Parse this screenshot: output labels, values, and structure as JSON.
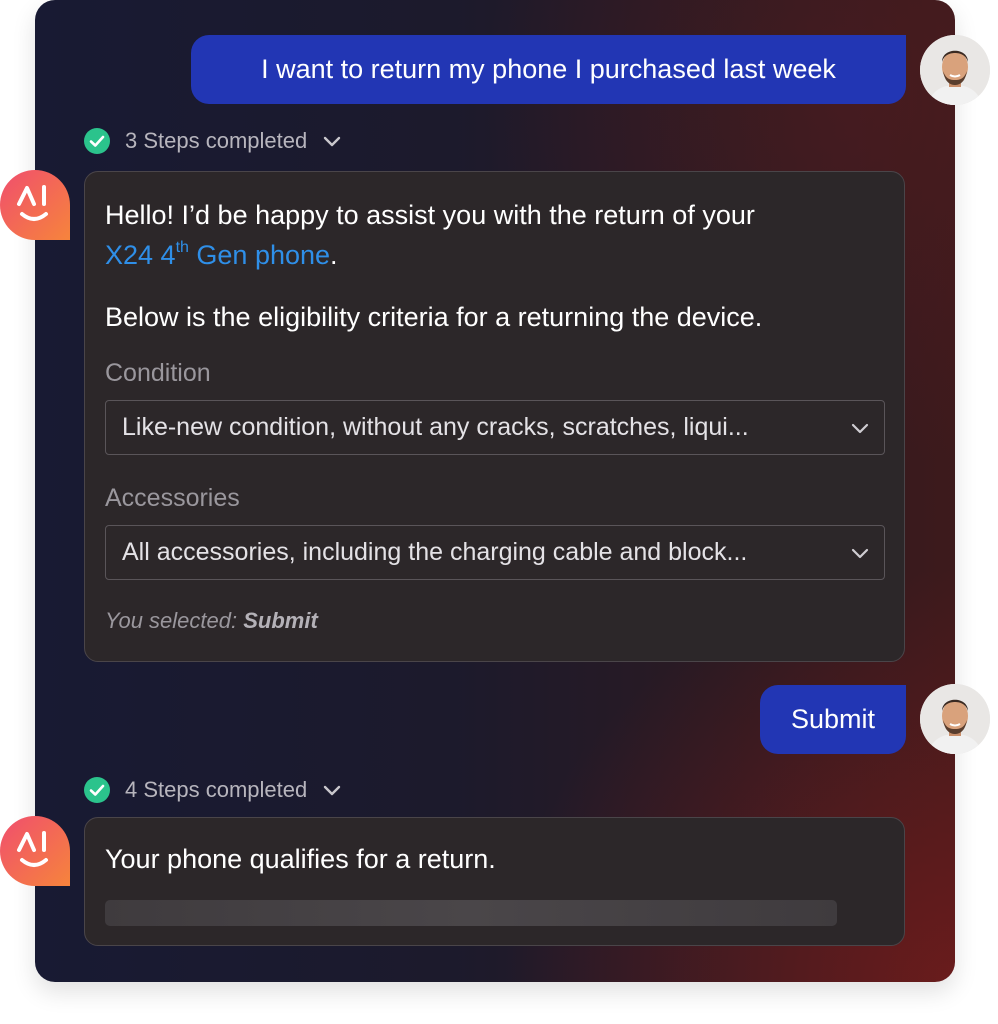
{
  "conversation": {
    "user_message_1": "I want to return my phone I purchased last week",
    "steps_1": "3 Steps completed",
    "ai_reply_1": {
      "greeting": "Hello! I’d be happy to assist you with the return of your",
      "product_name": "X24 4",
      "product_sup": "th",
      "product_rest": " Gen phone",
      "period": ".",
      "criteria_intro": "Below is the eligibility criteria for a returning the device.",
      "condition_label": "Condition",
      "condition_value": "Like-new condition, without any cracks, scratches, liqui...",
      "accessories_label": "Accessories",
      "accessories_value": "All accessories, including the charging cable and block...",
      "selected_prefix": "You selected: ",
      "selected_value": "Submit"
    },
    "user_message_2": "Submit",
    "steps_2": "4 Steps completed",
    "ai_reply_2": {
      "text": "Your phone qualifies for a return."
    }
  },
  "icons": {
    "check": "check-circle-icon",
    "chevron": "chevron-down-icon",
    "ai_logo": "ai-logo-icon",
    "avatar": "user-avatar"
  },
  "colors": {
    "user_bubble": "#2236b4",
    "link": "#2f8fe8",
    "check": "#2bc38c",
    "ai_logo_start": "#f04e6e",
    "ai_logo_end": "#f6843c"
  }
}
